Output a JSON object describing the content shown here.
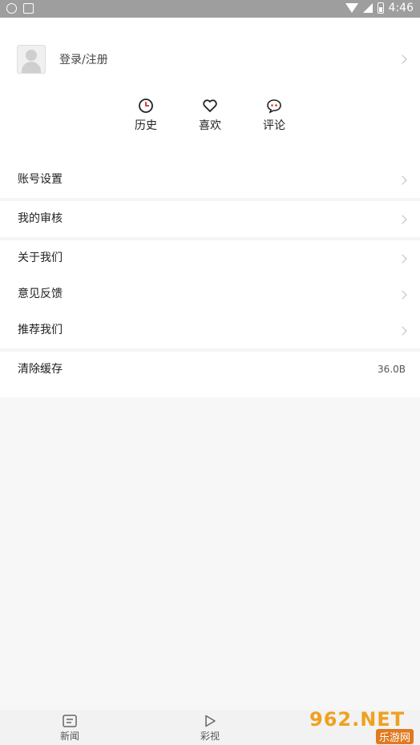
{
  "status_bar": {
    "time": "4:46"
  },
  "profile": {
    "login_label": "登录/注册"
  },
  "shortcuts": [
    {
      "label": "历史",
      "icon": "clock-icon"
    },
    {
      "label": "喜欢",
      "icon": "heart-icon"
    },
    {
      "label": "评论",
      "icon": "comment-icon"
    }
  ],
  "menu": {
    "account_settings": "账号设置",
    "my_review": "我的审核",
    "about_us": "关于我们",
    "feedback": "意见反馈",
    "recommend_us": "推荐我们",
    "clear_cache": "清除缓存",
    "cache_size": "36.0B"
  },
  "tabs": [
    {
      "label": "新闻",
      "icon": "news-icon"
    },
    {
      "label": "彩视",
      "icon": "play-icon"
    }
  ],
  "watermark": {
    "brand": "962.NET",
    "sub": "乐游网"
  },
  "colors": {
    "accent": "#d32f2f",
    "status_bar": "#9e9e9e"
  }
}
